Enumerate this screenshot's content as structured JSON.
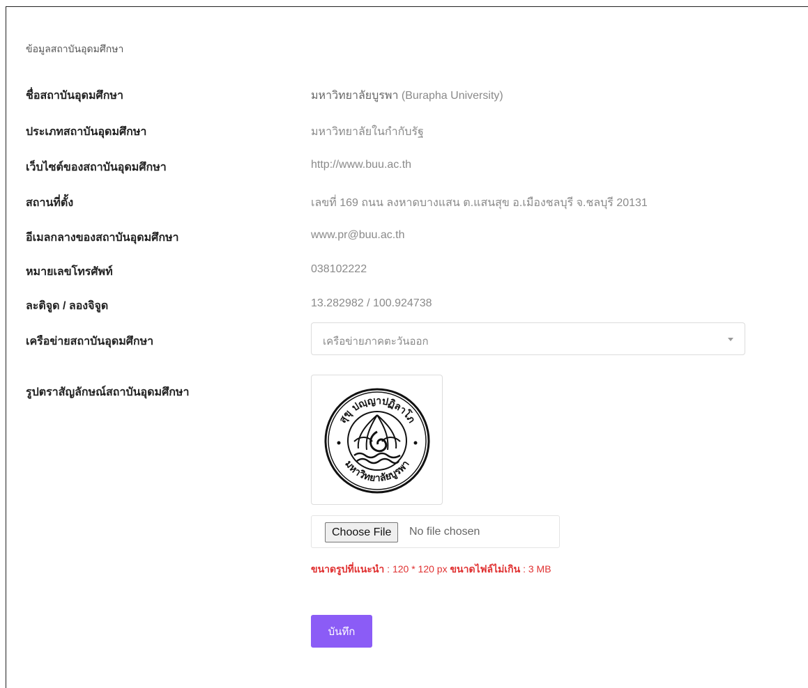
{
  "section_title": "ข้อมูลสถาบันอุดมศึกษา",
  "fields": [
    {
      "label": "ชื่อสถาบันอุดมศึกษา",
      "value_thai": "มหาวิทยาลัยบูรพา",
      "value": " (Burapha University)"
    },
    {
      "label": "ประเภทสถาบันอุดมศึกษา",
      "value": "มหาวิทยาลัยในกำกับรัฐ"
    },
    {
      "label": "เว็บไซต์ของสถาบันอุดมศึกษา",
      "value": "http://www.buu.ac.th"
    },
    {
      "label": "สถานที่ตั้ง",
      "value": "เลขที่ 169 ถนน ลงหาดบางแสน ต.แสนสุข อ.เมืองชลบุรี จ.ชลบุรี 20131"
    },
    {
      "label": "อีเมลกลางของสถาบันอุดมศึกษา",
      "value": "www.pr@buu.ac.th"
    },
    {
      "label": "หมายเลขโทรศัพท์",
      "value": "038102222"
    },
    {
      "label": "ละติจูด / ลองจิจูด",
      "value": "13.282982 / 100.924738"
    }
  ],
  "network": {
    "label": "เครือข่ายสถาบันอุดมศึกษา",
    "selected": "เครือข่ายภาคตะวันออก"
  },
  "logo": {
    "label": "รูปตราสัญลักษณ์สถาบันอุดมศึกษา",
    "seal_text_top": "สุขุ ปญฺญาปฏิลาโภ",
    "seal_text_bottom": "มหาวิทยาลัยบูรพา"
  },
  "file_input": {
    "button": "Choose File",
    "status": "No file chosen"
  },
  "hint": {
    "size_label": "ขนาดรูปที่แนะนำ",
    "size_value": " : 120 * 120 px ",
    "file_label": "ขนาดไฟล์ไม่เกิน",
    "file_value": " : 3 MB"
  },
  "save_button": "บันทึก"
}
